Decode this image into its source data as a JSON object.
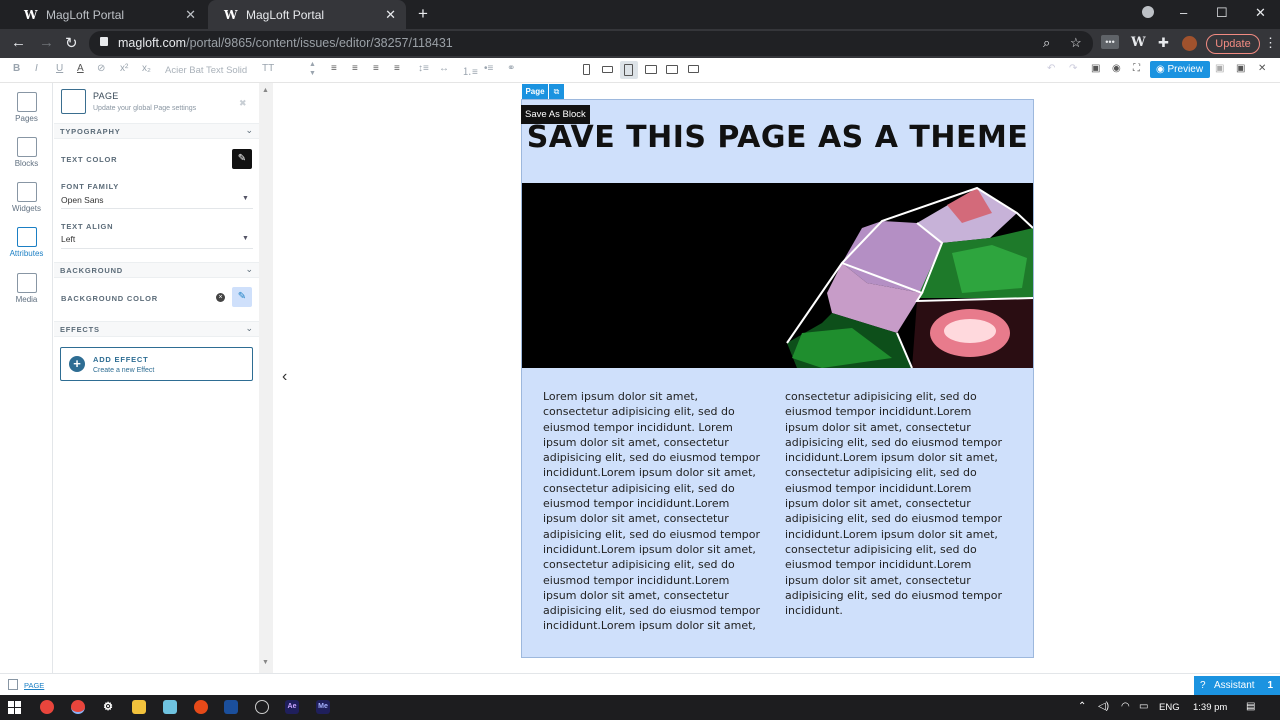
{
  "browser": {
    "tabs": [
      {
        "title": "MagLoft Portal",
        "active": false
      },
      {
        "title": "MagLoft Portal",
        "active": true
      }
    ],
    "new_tab": "+",
    "url_host": "magloft.com",
    "url_path": "/portal/9865/content/issues/editor/38257/118431",
    "update_label": "Update"
  },
  "toolbar": {
    "font_name": "Acier Bat Text Solid",
    "preview_label": "Preview"
  },
  "rail": {
    "items": [
      {
        "label": "Pages",
        "icon": "page-icon"
      },
      {
        "label": "Blocks",
        "icon": "puzzle-icon"
      },
      {
        "label": "Widgets",
        "icon": "widget-icon"
      },
      {
        "label": "Attributes",
        "icon": "gear-page-icon",
        "active": true
      },
      {
        "label": "Media",
        "icon": "media-icon"
      }
    ]
  },
  "panel": {
    "title": "PAGE",
    "subtitle": "Update your global Page settings",
    "typography": "TYPOGRAPHY",
    "text_color_label": "TEXT COLOR",
    "font_family_label": "FONT FAMILY",
    "font_family_value": "Open Sans",
    "text_align_label": "TEXT ALIGN",
    "text_align_value": "Left",
    "background": "BACKGROUND",
    "background_color_label": "BACKGROUND COLOR",
    "effects": "EFFECTS",
    "add_effect_title": "ADD EFFECT",
    "add_effect_sub": "Create a new Effect"
  },
  "canvas": {
    "page_tag": "Page",
    "tooltip": "Save As Block",
    "headline": "SAVE THIS PAGE AS A THEME",
    "col1": "Lorem ipsum dolor sit amet, consectetur adipisicing elit, sed do eiusmod tempor incididunt. Lorem ipsum dolor sit amet, consectetur adipisicing elit, sed do eiusmod tempor incididunt.Lorem ipsum dolor sit amet, consectetur adipisicing elit, sed do eiusmod tempor incididunt.Lorem ipsum dolor sit amet, consectetur adipisicing elit, sed do eiusmod tempor incididunt.Lorem ipsum dolor sit amet, consectetur adipisicing elit, sed do eiusmod tempor incididunt.Lorem ipsum dolor sit amet, consectetur adipisicing elit, sed do eiusmod tempor incididunt.Lorem ipsum dolor sit amet,",
    "col2": "consectetur adipisicing elit, sed do eiusmod tempor incididunt.Lorem ipsum dolor sit amet, consectetur adipisicing elit, sed do eiusmod tempor incididunt.Lorem ipsum dolor sit amet, consectetur adipisicing elit, sed do eiusmod tempor incididunt.Lorem ipsum dolor sit amet, consectetur adipisicing elit, sed do eiusmod tempor incididunt.Lorem ipsum dolor sit amet, consectetur adipisicing elit, sed do eiusmod tempor incididunt.Lorem ipsum dolor sit amet, consectetur adipisicing elit, sed do eiusmod tempor incididunt.",
    "page_bg": "#cfe0fb"
  },
  "status": {
    "page_link": "PAGE",
    "assistant_label": "Assistant",
    "assistant_count": "1"
  },
  "taskbar": {
    "lang": "ENG",
    "time": "1:39 pm",
    "apps": [
      "Ae",
      "Me"
    ]
  },
  "colors": {
    "accent": "#1b93e0",
    "panel_accent": "#2e6d93"
  }
}
